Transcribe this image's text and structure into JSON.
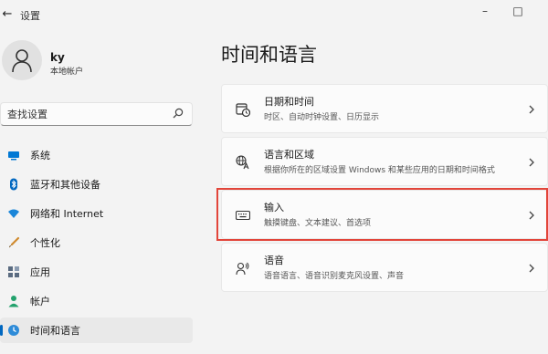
{
  "window": {
    "title": "设置",
    "minimize_glyph": "–",
    "maximize_glyph": "□",
    "back_glyph": "←"
  },
  "user": {
    "name": "ky",
    "account_type": "本地帐户"
  },
  "search": {
    "placeholder": "查找设置",
    "value": ""
  },
  "sidebar": {
    "items": [
      {
        "label": "系统",
        "icon": "system-icon",
        "color": "#0078d4"
      },
      {
        "label": "蓝牙和其他设备",
        "icon": "bluetooth-icon",
        "color": "#0067c0"
      },
      {
        "label": "网络和 Internet",
        "icon": "network-icon",
        "color": "#1a86d9"
      },
      {
        "label": "个性化",
        "icon": "brush-icon",
        "color": "#d08b2f"
      },
      {
        "label": "应用",
        "icon": "apps-icon",
        "color": "#5a6b80"
      },
      {
        "label": "帐户",
        "icon": "account-icon",
        "color": "#23a26d"
      },
      {
        "label": "时间和语言",
        "icon": "time-language-icon",
        "color": "#2e8bd8",
        "active": true
      }
    ]
  },
  "main": {
    "title": "时间和语言",
    "cards": [
      {
        "title": "日期和时间",
        "subtitle": "时区、自动时钟设置、日历显示",
        "icon": "clock-calendar-icon"
      },
      {
        "title": "语言和区域",
        "subtitle": "根据你所在的区域设置 Windows 和某些应用的日期和时间格式",
        "icon": "language-icon"
      },
      {
        "title": "输入",
        "subtitle": "触摸键盘、文本建议、首选项",
        "icon": "keyboard-icon",
        "highlighted": true
      },
      {
        "title": "语音",
        "subtitle": "语音语言、语音识别麦克风设置、声音",
        "icon": "speech-icon"
      }
    ]
  },
  "colors": {
    "accent": "#0067c0",
    "highlight_border": "#e2453a",
    "background": "#f3f3f3",
    "card": "#fbfbfb"
  }
}
